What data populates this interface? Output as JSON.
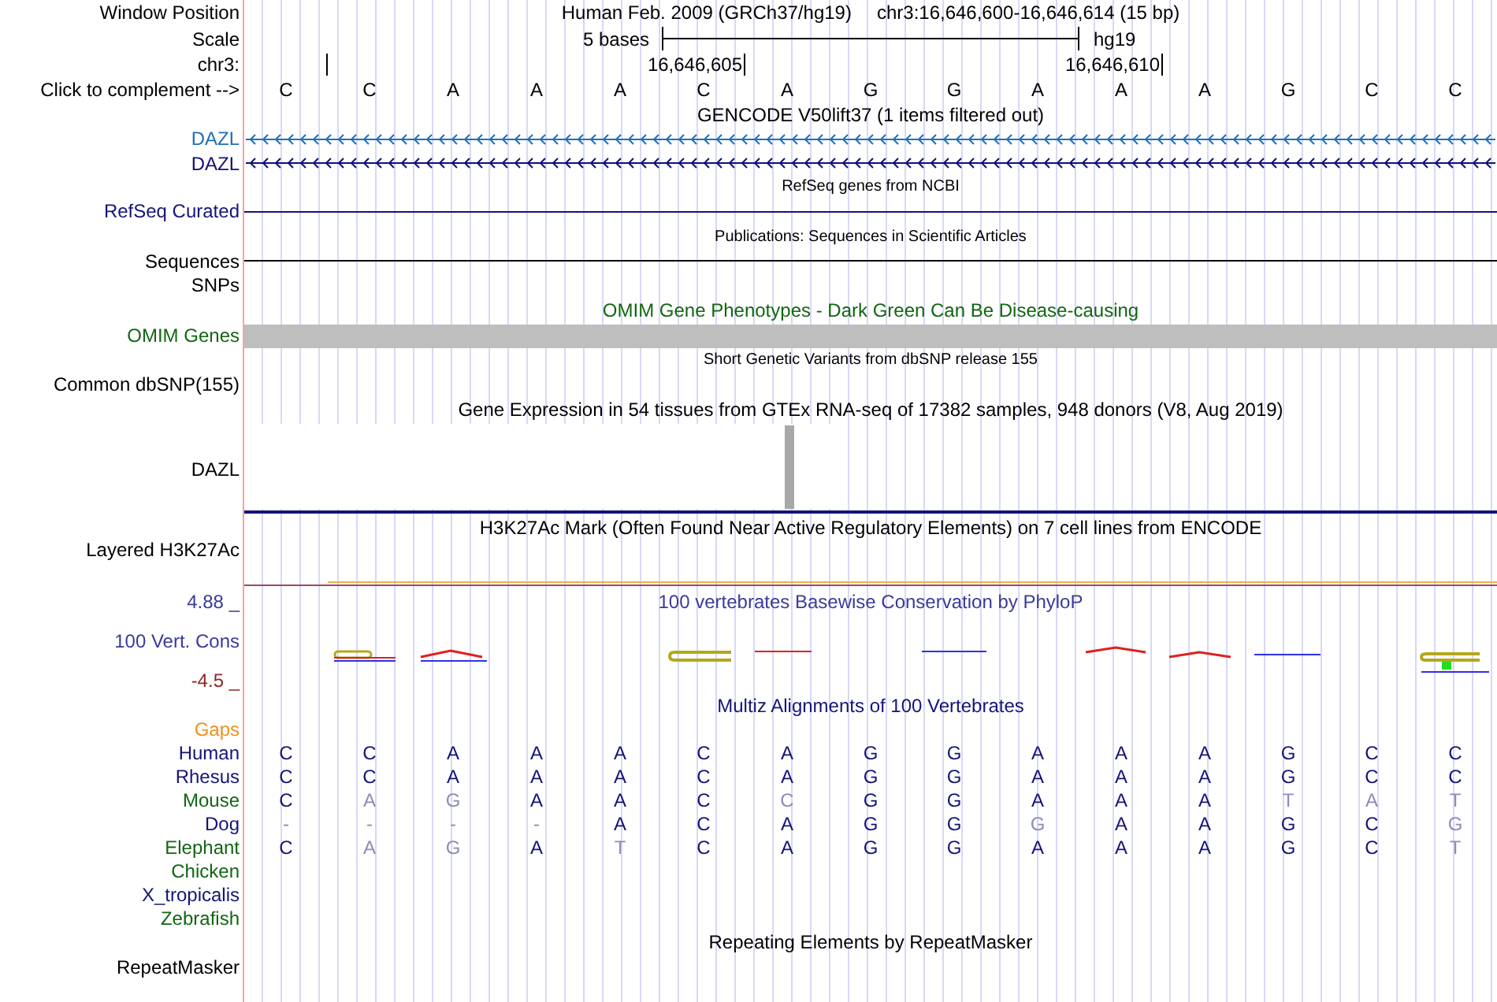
{
  "position": {
    "label": "Window Position",
    "assembly": "Human Feb. 2009 (GRCh37/hg19)",
    "range": "chr3:16,646,600-16,646,614 (15 bp)"
  },
  "scale": {
    "label": "Scale",
    "span": "5 bases",
    "assembly": "hg19"
  },
  "ruler": {
    "label": "chr3:",
    "ticks": [
      "16,646,605",
      "16,646,610"
    ]
  },
  "complement": {
    "label": "Click to complement -->",
    "bases": [
      "C",
      "C",
      "A",
      "A",
      "A",
      "C",
      "A",
      "G",
      "G",
      "A",
      "A",
      "A",
      "G",
      "C",
      "C"
    ]
  },
  "gencode": {
    "title": "GENCODE V50lift37 (1 items filtered out)",
    "genes": [
      {
        "label": "DAZL",
        "color": "#1f70b8"
      },
      {
        "label": "DAZL",
        "color": "#10107a"
      }
    ]
  },
  "refseq": {
    "title": "RefSeq genes from NCBI",
    "label": "RefSeq Curated"
  },
  "publications": {
    "title": "Publications: Sequences in Scientific Articles",
    "rows": [
      {
        "label": "Sequences",
        "kind": "line"
      },
      {
        "label": "SNPs",
        "kind": "empty"
      }
    ]
  },
  "omim": {
    "title": "OMIM Gene Phenotypes - Dark Green Can Be Disease-causing",
    "label": "OMIM Genes"
  },
  "dbsnp": {
    "title": "Short Genetic Variants from dbSNP release 155",
    "label": "Common dbSNP(155)"
  },
  "gtex": {
    "title": "Gene Expression in 54 tissues from GTEx RNA-seq of 17382 samples, 948 donors (V8, Aug 2019)",
    "label": "DAZL"
  },
  "h3k27ac": {
    "title": "H3K27Ac Mark (Often Found Near Active Regulatory Elements) on 7 cell lines from ENCODE",
    "label": "Layered H3K27Ac"
  },
  "phylop": {
    "title": "100 vertebrates Basewise Conservation by PhyloP",
    "label": "100 Vert. Cons",
    "max_label": "4.88 _",
    "min_label": "-4.5 _"
  },
  "multiz": {
    "title": "Multiz Alignments of 100 Vertebrates",
    "gaps_label": "Gaps",
    "species": [
      {
        "name": "Human",
        "color": "#14147a",
        "bases": [
          {
            "base": "C",
            "match": true
          },
          {
            "base": "C",
            "match": true
          },
          {
            "base": "A",
            "match": true
          },
          {
            "base": "A",
            "match": true
          },
          {
            "base": "A",
            "match": true
          },
          {
            "base": "C",
            "match": true
          },
          {
            "base": "A",
            "match": true
          },
          {
            "base": "G",
            "match": true
          },
          {
            "base": "G",
            "match": true
          },
          {
            "base": "A",
            "match": true
          },
          {
            "base": "A",
            "match": true
          },
          {
            "base": "A",
            "match": true
          },
          {
            "base": "G",
            "match": true
          },
          {
            "base": "C",
            "match": true
          },
          {
            "base": "C",
            "match": true
          }
        ]
      },
      {
        "name": "Rhesus",
        "color": "#14147a",
        "bases": [
          {
            "base": "C",
            "match": true
          },
          {
            "base": "C",
            "match": true
          },
          {
            "base": "A",
            "match": true
          },
          {
            "base": "A",
            "match": true
          },
          {
            "base": "A",
            "match": true
          },
          {
            "base": "C",
            "match": true
          },
          {
            "base": "A",
            "match": true
          },
          {
            "base": "G",
            "match": true
          },
          {
            "base": "G",
            "match": true
          },
          {
            "base": "A",
            "match": true
          },
          {
            "base": "A",
            "match": true
          },
          {
            "base": "A",
            "match": true
          },
          {
            "base": "G",
            "match": true
          },
          {
            "base": "C",
            "match": true
          },
          {
            "base": "C",
            "match": true
          }
        ]
      },
      {
        "name": "Mouse",
        "color": "#116611",
        "bases": [
          {
            "base": "C",
            "match": true
          },
          {
            "base": "A",
            "match": false
          },
          {
            "base": "G",
            "match": false
          },
          {
            "base": "A",
            "match": true
          },
          {
            "base": "A",
            "match": true
          },
          {
            "base": "C",
            "match": true
          },
          {
            "base": "C",
            "match": false
          },
          {
            "base": "G",
            "match": true
          },
          {
            "base": "G",
            "match": true
          },
          {
            "base": "A",
            "match": true
          },
          {
            "base": "A",
            "match": true
          },
          {
            "base": "A",
            "match": true
          },
          {
            "base": "T",
            "match": false
          },
          {
            "base": "A",
            "match": false
          },
          {
            "base": "T",
            "match": false
          }
        ]
      },
      {
        "name": "Dog",
        "color": "#14147a",
        "bases": [
          {
            "base": "-",
            "match": false
          },
          {
            "base": "-",
            "match": false
          },
          {
            "base": "-",
            "match": false
          },
          {
            "base": "-",
            "match": false
          },
          {
            "base": "A",
            "match": true
          },
          {
            "base": "C",
            "match": true
          },
          {
            "base": "A",
            "match": true
          },
          {
            "base": "G",
            "match": true
          },
          {
            "base": "G",
            "match": true
          },
          {
            "base": "G",
            "match": false
          },
          {
            "base": "A",
            "match": true
          },
          {
            "base": "A",
            "match": true
          },
          {
            "base": "G",
            "match": true
          },
          {
            "base": "C",
            "match": true
          },
          {
            "base": "G",
            "match": false
          }
        ]
      },
      {
        "name": "Elephant",
        "color": "#116611",
        "bases": [
          {
            "base": "C",
            "match": true
          },
          {
            "base": "A",
            "match": false
          },
          {
            "base": "G",
            "match": false
          },
          {
            "base": "A",
            "match": true
          },
          {
            "base": "T",
            "match": false
          },
          {
            "base": "C",
            "match": true
          },
          {
            "base": "A",
            "match": true
          },
          {
            "base": "G",
            "match": true
          },
          {
            "base": "G",
            "match": true
          },
          {
            "base": "A",
            "match": true
          },
          {
            "base": "A",
            "match": true
          },
          {
            "base": "A",
            "match": true
          },
          {
            "base": "G",
            "match": true
          },
          {
            "base": "C",
            "match": true
          },
          {
            "base": "T",
            "match": false
          }
        ]
      },
      {
        "name": "Chicken",
        "color": "#116611"
      },
      {
        "name": "X_tropicalis",
        "color": "#14147a"
      },
      {
        "name": "Zebrafish",
        "color": "#116611"
      }
    ]
  },
  "repeatmasker": {
    "title": "Repeating Elements by RepeatMasker",
    "label": "RepeatMasker"
  }
}
